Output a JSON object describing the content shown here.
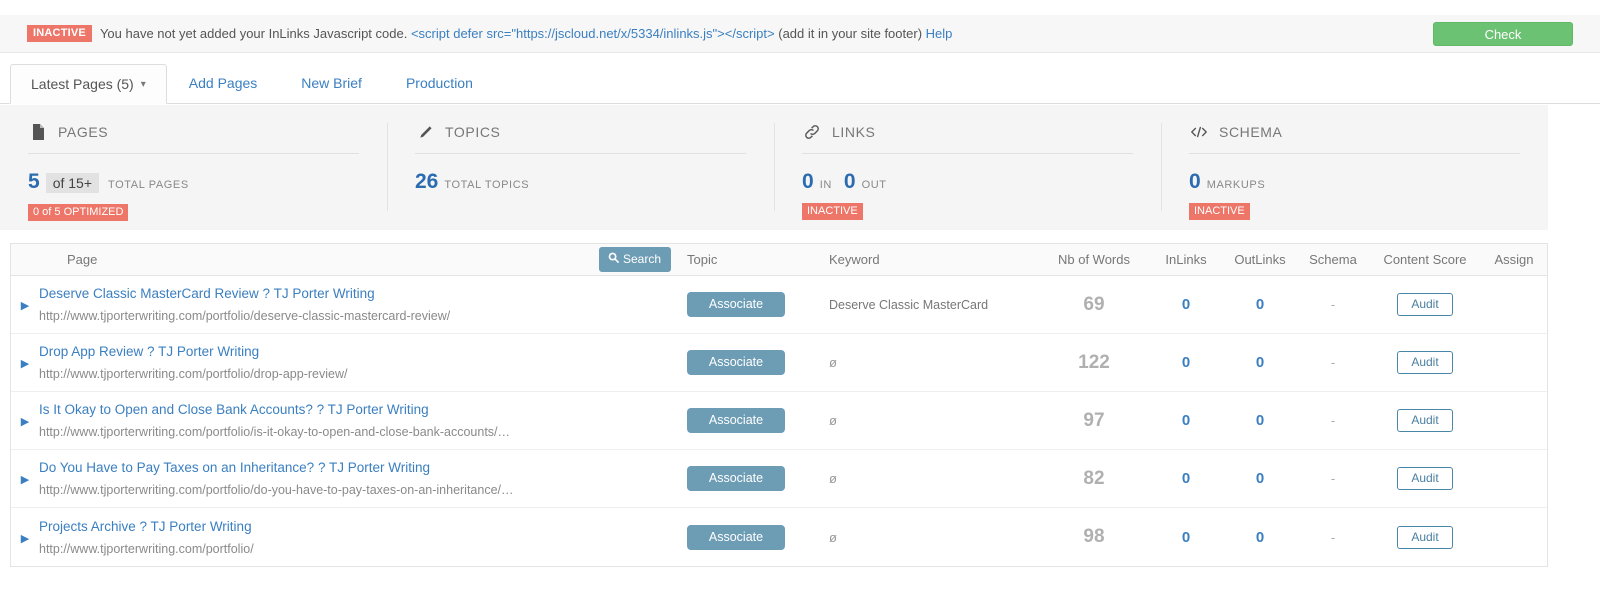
{
  "alert": {
    "badge": "INACTIVE",
    "text_before": "You have not yet added your InLinks Javascript code.",
    "code": "<script defer src=\"https://jscloud.net/x/5334/inlinks.js\"></script>",
    "text_after": "(add it in your site footer)",
    "help": "Help",
    "check_button": "Check",
    "accent": "#ed7669",
    "check_color": "#6cc273"
  },
  "tabs": [
    {
      "label": "Latest Pages (5)",
      "active": true,
      "caret": "⌄"
    },
    {
      "label": "Add Pages",
      "active": false
    },
    {
      "label": "New Brief",
      "active": false
    },
    {
      "label": "Production",
      "active": false
    }
  ],
  "kpis": [
    {
      "icon": "document-icon",
      "title": "PAGES",
      "value": "5",
      "pill": "of 15+",
      "unit": "TOTAL PAGES",
      "badge": "0 of 5 OPTIMIZED",
      "badge_color": "#ed7669"
    },
    {
      "icon": "pencil-icon",
      "title": "TOPICS",
      "value": "26",
      "unit": "TOTAL TOPICS"
    },
    {
      "icon": "link-icon",
      "title": "LINKS",
      "value": "0",
      "unit": "IN",
      "value2": "0",
      "unit2": "OUT",
      "badge": "INACTIVE",
      "badge_color": "#ed7669"
    },
    {
      "icon": "code-icon",
      "title": "SCHEMA",
      "value": "0",
      "unit": "MARKUPS",
      "badge": "INACTIVE",
      "badge_color": "#ed7669"
    }
  ],
  "table": {
    "headers": {
      "page": "Page",
      "search": "Search",
      "topic": "Topic",
      "keyword": "Keyword",
      "words": "Nb of Words",
      "inlinks": "InLinks",
      "outlinks": "OutLinks",
      "schema": "Schema",
      "score": "Content Score",
      "assign": "Assign"
    },
    "associate_label": "Associate",
    "audit_label": "Audit",
    "rows": [
      {
        "title": "Deserve Classic MasterCard Review ? TJ Porter Writing",
        "url": "http://www.tjporterwriting.com/portfolio/deserve-classic-mastercard-review/",
        "keyword": "Deserve Classic MasterCard",
        "words": "69",
        "inlinks": "0",
        "outlinks": "0",
        "schema": "-"
      },
      {
        "title": "Drop App Review ? TJ Porter Writing",
        "url": "http://www.tjporterwriting.com/portfolio/drop-app-review/",
        "keyword": "ø",
        "words": "122",
        "inlinks": "0",
        "outlinks": "0",
        "schema": "-"
      },
      {
        "title": "Is It Okay to Open and Close Bank Accounts? ? TJ Porter Writing",
        "url": "http://www.tjporterwriting.com/portfolio/is-it-okay-to-open-and-close-bank-accounts/…",
        "keyword": "ø",
        "words": "97",
        "inlinks": "0",
        "outlinks": "0",
        "schema": "-"
      },
      {
        "title": "Do You Have to Pay Taxes on an Inheritance? ? TJ Porter Writing",
        "url": "http://www.tjporterwriting.com/portfolio/do-you-have-to-pay-taxes-on-an-inheritance/…",
        "keyword": "ø",
        "words": "82",
        "inlinks": "0",
        "outlinks": "0",
        "schema": "-"
      },
      {
        "title": "Projects Archive ? TJ Porter Writing",
        "url": "http://www.tjporterwriting.com/portfolio/",
        "keyword": "ø",
        "words": "98",
        "inlinks": "0",
        "outlinks": "0",
        "schema": "-"
      }
    ]
  }
}
